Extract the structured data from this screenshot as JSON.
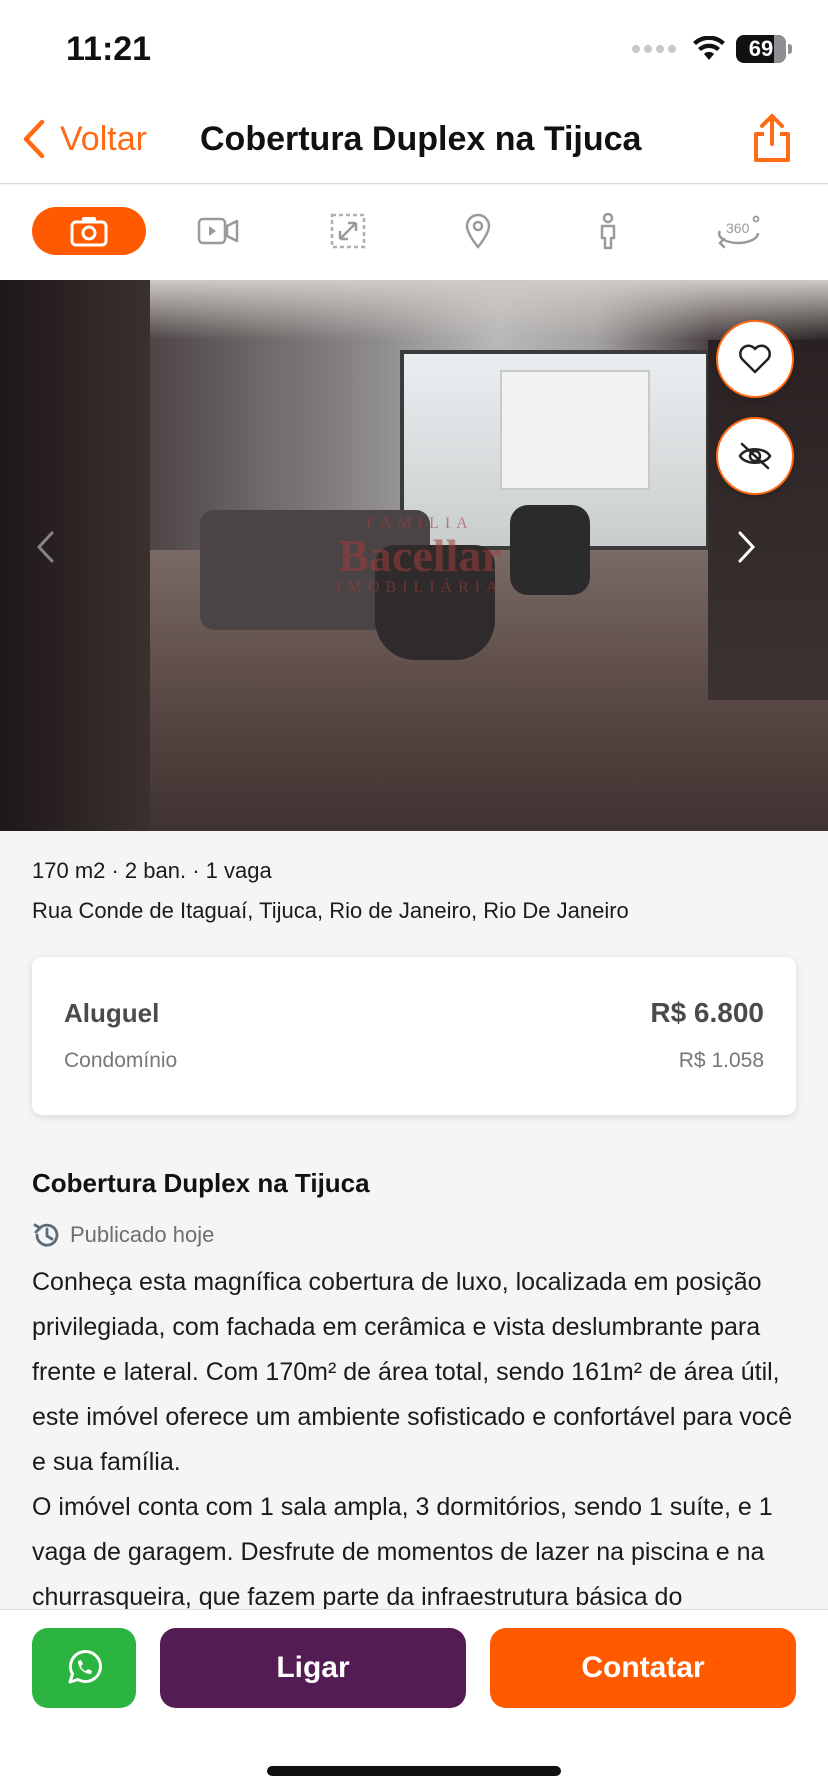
{
  "status_bar": {
    "time": "11:21",
    "battery": "69"
  },
  "nav": {
    "back_label": "Voltar",
    "title": "Cobertura Duplex na Tijuca"
  },
  "media_tabs": [
    {
      "icon": "camera-icon",
      "active": true
    },
    {
      "icon": "video-icon",
      "active": false
    },
    {
      "icon": "floorplan-icon",
      "active": false
    },
    {
      "icon": "map-pin-icon",
      "active": false
    },
    {
      "icon": "street-view-icon",
      "active": false
    },
    {
      "icon": "360-view-icon",
      "active": false
    }
  ],
  "photo": {
    "watermark_brand": "Bacellar",
    "watermark_top": "FAMILIA",
    "watermark_sub": "IMOBILIÁRIA"
  },
  "listing": {
    "features": "170 m2 · 2  ban. · 1 vaga",
    "address": "Rua Conde de Itaguaí, Tijuca, Rio de Janeiro, Rio De Janeiro"
  },
  "price": {
    "rent_label": "Aluguel",
    "rent_value": "R$ 6.800",
    "condo_label": "Condomínio",
    "condo_value": "R$ 1.058"
  },
  "description": {
    "title": "Cobertura Duplex na Tijuca",
    "published": "Publicado hoje",
    "text": "Conheça esta magnífica cobertura de luxo, localizada em posição privilegiada, com fachada em cerâmica e vista deslumbrante para frente e lateral. Com 170m² de área total, sendo 161m² de área útil, este imóvel oferece um ambiente sofisticado e confortável para você e sua família.\n O imóvel conta com 1 sala ampla, 3 dormitórios, sendo 1 suíte, e 1 vaga de garagem. Desfrute de momentos de lazer na piscina e na churrasqueira, que fazem parte da infraestrutura básica do"
  },
  "actions": {
    "whatsapp_icon": "whatsapp-icon",
    "call_label": "Ligar",
    "contact_label": "Contatar"
  },
  "colors": {
    "accent": "#ff5a00",
    "call": "#531c53",
    "whatsapp": "#2bb540"
  }
}
